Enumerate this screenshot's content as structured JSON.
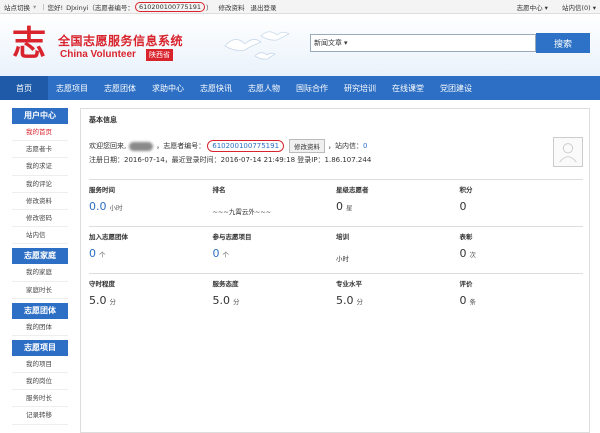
{
  "topbar": {
    "switch": "站点切换",
    "greeting": "您好!",
    "user_prefix": "DJxinyi（志愿者编号：",
    "volunteer_id": "610200100775191",
    "user_suffix": "）",
    "edit_profile": "修改资料",
    "logout": "退出登录",
    "center": "志愿中心",
    "inbox": "站内信(0)"
  },
  "header": {
    "logo_mark": "志",
    "site_name_cn": "全国志愿服务信息系统",
    "site_name_en": "China Volunteer",
    "province": "陕西省",
    "search_category": "新闻文章",
    "search_button": "搜索"
  },
  "nav": [
    "首页",
    "志愿项目",
    "志愿团体",
    "求助中心",
    "志愿快讯",
    "志愿人物",
    "国际合作",
    "研究培训",
    "在线课堂",
    "党团建设"
  ],
  "sidebar": {
    "sections": [
      {
        "title": "用户中心",
        "items": [
          "我的首页",
          "志愿者卡",
          "我的求证",
          "我的评论",
          "修改资料",
          "修改密码",
          "站内信"
        ]
      },
      {
        "title": "志愿家庭",
        "items": [
          "我的家庭",
          "家庭时长"
        ]
      },
      {
        "title": "志愿团体",
        "items": [
          "我的团体"
        ]
      },
      {
        "title": "志愿项目",
        "items": [
          "我的项目",
          "我的岗位",
          "服务时长",
          "记录转移"
        ]
      }
    ]
  },
  "info": {
    "section_title": "基本信息",
    "welcome": "欢迎您回来,",
    "id_label": "，志愿者编号：",
    "id_value": "610200100775191",
    "edit_button": "修改资料",
    "inbox_label": "，站内信：",
    "inbox_count": "0",
    "register_line": "注册日期：2016-07-14，最近登录时间：2016-07-14 21:49:18  登录IP：1.86.107.244"
  },
  "stats": {
    "row1": [
      {
        "label": "服务时间",
        "value": "0.0",
        "unit": "小时",
        "blue": true
      },
      {
        "label": "排名",
        "text": "~~~九霄云外~~~"
      },
      {
        "label": "星级志愿者",
        "value": "0",
        "unit": "星"
      },
      {
        "label": "积分",
        "value": "0",
        "unit": ""
      }
    ],
    "row2": [
      {
        "label": "加入志愿团体",
        "value": "0",
        "unit": "个",
        "blue": true
      },
      {
        "label": "参与志愿项目",
        "value": "0",
        "unit": "个",
        "blue": true
      },
      {
        "label": "培训",
        "text": "小时"
      },
      {
        "label": "表彰",
        "value": "0",
        "unit": "次"
      }
    ],
    "row3": [
      {
        "label": "守时程度",
        "value": "5.0",
        "unit": "分"
      },
      {
        "label": "服务态度",
        "value": "5.0",
        "unit": "分"
      },
      {
        "label": "专业水平",
        "value": "5.0",
        "unit": "分"
      },
      {
        "label": "评价",
        "value": "0",
        "unit": "条"
      }
    ]
  },
  "colors": {
    "accent": "#2d6fc4",
    "brand_red": "#d9242d"
  }
}
